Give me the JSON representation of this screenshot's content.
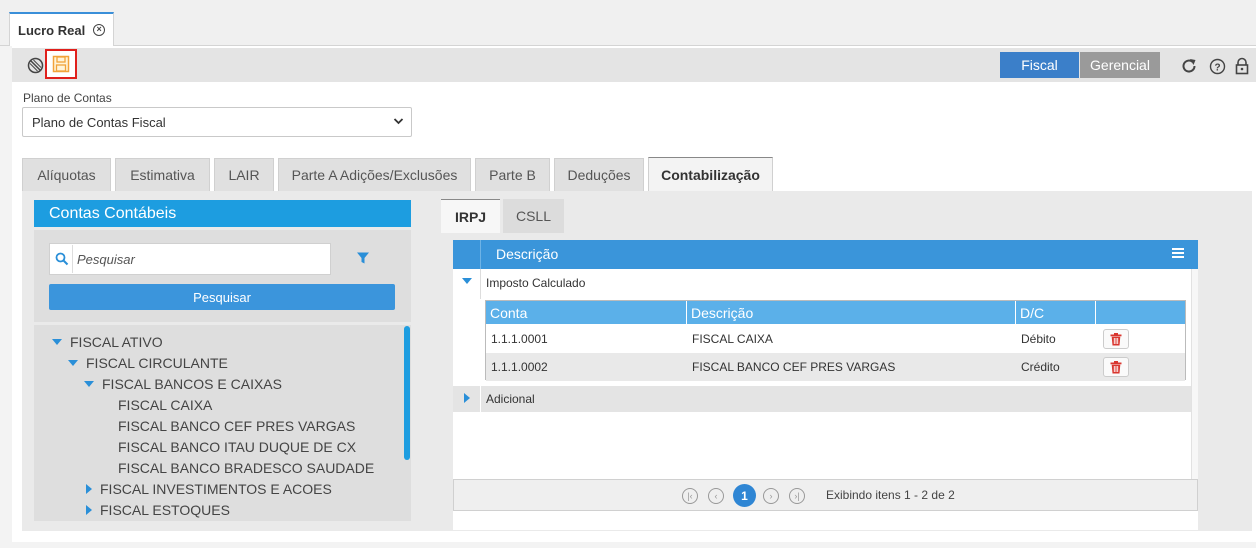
{
  "window": {
    "tab_title": "Lucro Real"
  },
  "toolbar": {
    "btn_fiscal": "Fiscal",
    "btn_gerencial": "Gerencial",
    "accent": "#3a8fd9"
  },
  "form": {
    "plano_label": "Plano de Contas",
    "plano_value": "Plano de Contas Fiscal"
  },
  "tabs": [
    {
      "label": "Alíquotas"
    },
    {
      "label": "Estimativa"
    },
    {
      "label": "LAIR"
    },
    {
      "label": "Parte A Adições/Exclusões"
    },
    {
      "label": "Parte B"
    },
    {
      "label": "Deduções"
    },
    {
      "label": "Contabilização",
      "active": true
    }
  ],
  "contas": {
    "header": "Contas Contábeis",
    "search_placeholder": "Pesquisar",
    "search_button": "Pesquisar",
    "tree": [
      {
        "label": "FISCAL ATIVO",
        "state": "expanded"
      },
      {
        "label": "FISCAL CIRCULANTE",
        "state": "expanded"
      },
      {
        "label": "FISCAL BANCOS E CAIXAS",
        "state": "expanded"
      },
      {
        "label": "FISCAL CAIXA",
        "state": "leaf"
      },
      {
        "label": "FISCAL BANCO CEF PRES VARGAS",
        "state": "leaf"
      },
      {
        "label": "FISCAL BANCO ITAU DUQUE DE CX",
        "state": "leaf"
      },
      {
        "label": "FISCAL BANCO BRADESCO SAUDADE",
        "state": "leaf"
      },
      {
        "label": "FISCAL INVESTIMENTOS E ACOES",
        "state": "collapsed"
      },
      {
        "label": "FISCAL ESTOQUES",
        "state": "collapsed"
      }
    ]
  },
  "subtabs": [
    {
      "label": "IRPJ",
      "active": true
    },
    {
      "label": "CSLL"
    }
  ],
  "grid": {
    "header": "Descrição",
    "group1": "Imposto Calculado",
    "group2": "Adicional",
    "inner_headers": [
      "Conta",
      "Descrição",
      "D/C"
    ],
    "rows": [
      {
        "conta": "1.1.1.0001",
        "descricao": "FISCAL CAIXA",
        "dc": "Débito"
      },
      {
        "conta": "1.1.1.0002",
        "descricao": "FISCAL BANCO CEF PRES VARGAS",
        "dc": "Crédito"
      }
    ]
  },
  "pager": {
    "current_page": "1",
    "info": "Exibindo itens 1 - 2 de 2"
  }
}
